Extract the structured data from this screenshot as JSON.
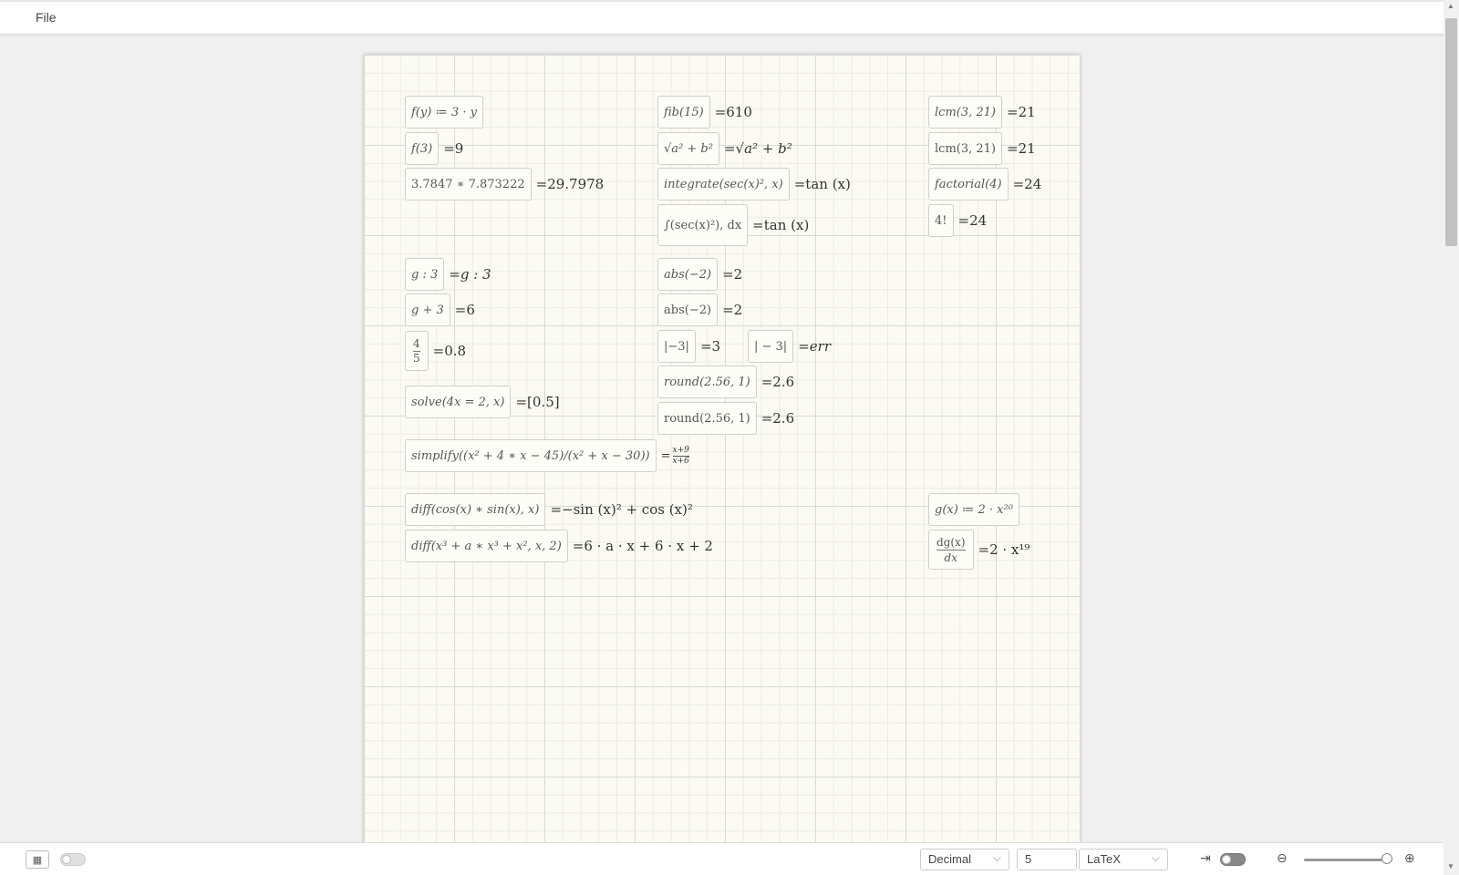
{
  "menubar": {
    "file_label": "File"
  },
  "sheet": {
    "cells": [
      {
        "id": "f-def",
        "input": "f(y) ≔ 3 · y",
        "result": ""
      },
      {
        "id": "f-call",
        "input": "f(3)",
        "result": "=9"
      },
      {
        "id": "mul",
        "input": "3.7847 ∗ 7.873222",
        "result": "=29.7978"
      },
      {
        "id": "g-colon",
        "input": "g : 3",
        "result": "=g : 3"
      },
      {
        "id": "g-plus",
        "input": "g + 3",
        "result": "=6"
      },
      {
        "id": "frac",
        "input_num": "4",
        "input_den": "5",
        "result": "=0.8"
      },
      {
        "id": "solve",
        "input": "solve(4x = 2, x)",
        "result": "=[0.5]"
      },
      {
        "id": "simplify",
        "input": "simplify((x² + 4 ∗ x − 45)/(x² + x − 30))",
        "result_num": "x+9",
        "result_den": "x+6",
        "result_prefix": "="
      },
      {
        "id": "diff1",
        "input": "diff(cos(x) ∗ sin(x), x)",
        "result": "=−sin (x)² + cos (x)²"
      },
      {
        "id": "diff2",
        "input": "diff(x³ + a ∗ x³ + x², x, 2)",
        "result": "=6 · a · x + 6 · x + 2"
      },
      {
        "id": "fib",
        "input": "fib(15)",
        "result": "=610"
      },
      {
        "id": "sqrt",
        "input": "√a² + b²",
        "result": "=√a² + b²"
      },
      {
        "id": "integrate",
        "input": "integrate(sec(x)², x)",
        "result": "=tan (x)"
      },
      {
        "id": "integral",
        "input": "∫(sec(x)²), dx",
        "result": "=tan (x)"
      },
      {
        "id": "abs1",
        "input": "abs(−2)",
        "result": "=2"
      },
      {
        "id": "abs2",
        "input": "abs(−2)",
        "result": "=2"
      },
      {
        "id": "bars1",
        "input": "|−3|",
        "result": "=3"
      },
      {
        "id": "bars2",
        "input": "| − 3|",
        "result": "=err"
      },
      {
        "id": "round1",
        "input": "round(2.56, 1)",
        "result": "=2.6"
      },
      {
        "id": "round2",
        "input": "round(2.56, 1)",
        "result": "=2.6"
      },
      {
        "id": "lcm1",
        "input": "lcm(3, 21)",
        "result": "=21"
      },
      {
        "id": "lcm2",
        "input": "lcm(3, 21)",
        "result": "=21"
      },
      {
        "id": "factorial",
        "input": "factorial(4)",
        "result": "=24"
      },
      {
        "id": "bang",
        "input": "4!",
        "result": "=24"
      },
      {
        "id": "g-def",
        "input": "g(x) ≔ 2 · x²⁰",
        "result": ""
      },
      {
        "id": "deriv",
        "input_num": "dg(x)",
        "input_den": "dx",
        "result": "=2 · x¹⁹"
      }
    ]
  },
  "statusbar": {
    "number_format": "Decimal",
    "precision": "5",
    "output_format": "LaTeX",
    "zoom_level": 1.0
  }
}
